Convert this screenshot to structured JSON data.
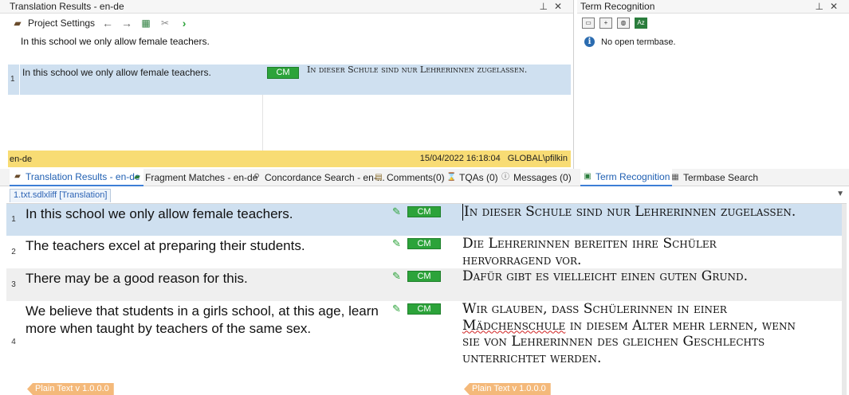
{
  "translation_results": {
    "title": "Translation Results - en-de",
    "title_controls": [
      "pin-icon",
      "close-icon"
    ],
    "toolbar": {
      "project_settings_label": "Project Settings"
    },
    "source_sentence": "In this school we only allow female teachers.",
    "match": {
      "number": "1",
      "source": "In this school we only allow female teachers.",
      "badge": "CM",
      "target": "In dieser Schule sind nur Lehrerinnen zugelassen."
    },
    "status": {
      "language": "en-de",
      "timestamp": "15/04/2022 16:18:04",
      "user": "GLOBAL\\pfilkin"
    }
  },
  "term_recognition": {
    "title": "Term Recognition",
    "message": "No open termbase."
  },
  "tabs": [
    {
      "label": "Translation Results - en-de",
      "active": true
    },
    {
      "label": "Fragment Matches - en-de",
      "active": false
    },
    {
      "label": "Concordance Search - en-...",
      "active": false
    },
    {
      "label": "Comments(0)",
      "active": false
    },
    {
      "label": "TQAs (0)",
      "active": false
    },
    {
      "label": "Messages (0)",
      "active": false
    },
    {
      "label": "Term Recognition",
      "active": true
    },
    {
      "label": "Termbase Search",
      "active": false
    }
  ],
  "editor": {
    "document_tab": "1.txt.sdlxliff [Translation]",
    "segments": [
      {
        "number": "1",
        "source": "In this school we only allow female teachers.",
        "status": "CM",
        "target": "In dieser Schule sind nur Lehrerinnen zugelassen.",
        "selected": true
      },
      {
        "number": "2",
        "source": "The teachers excel at preparing their students.",
        "status": "CM",
        "target": "Die Lehrerinnen bereiten ihre Schüler hervorragend vor."
      },
      {
        "number": "3",
        "source": "There may be a good reason for this.",
        "status": "CM",
        "target": "Dafür gibt es vielleicht einen guten Grund."
      },
      {
        "number": "4",
        "source": "We believe that students in a girls school, at this age, learn more when taught by teachers of the same sex.",
        "status": "CM",
        "target_before": "Wir glauben, dass Schülerinnen in einer ",
        "target_misspelled": "Mädchenschule",
        "target_after": " in diesem Alter mehr lernen, wenn sie von Lehrerinnen des gleichen Geschlechts unterrichtet werden."
      }
    ],
    "plain_text_tag": "Plain Text v 1.0.0.0"
  },
  "colors": {
    "selected_row": "#cfe0f0",
    "status_bar": "#f8dc74",
    "confirmed_badge": "#2ca33a",
    "tag": "#f4b97a",
    "active_tab_text": "#1f5fb2"
  }
}
